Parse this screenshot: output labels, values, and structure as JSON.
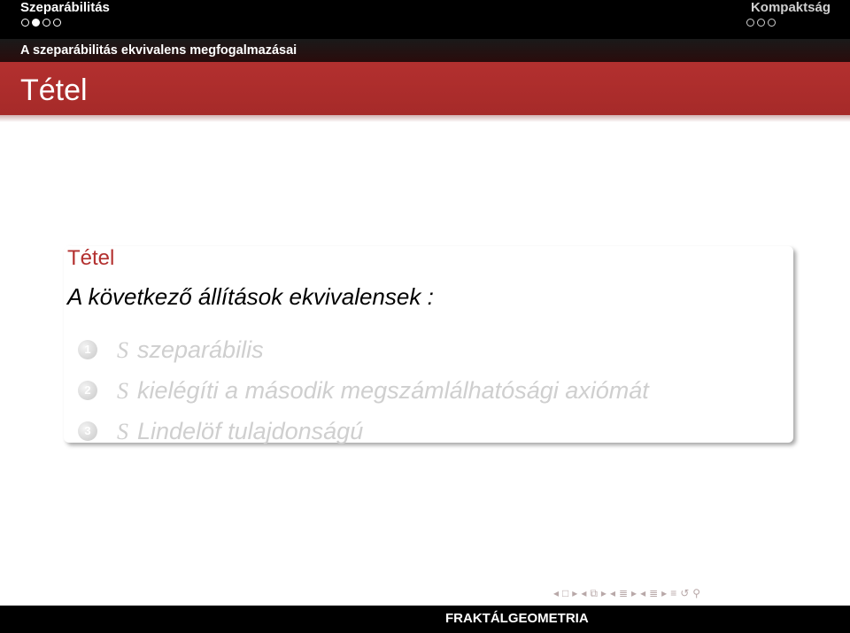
{
  "headline": {
    "section_left": "Szeparábilitás",
    "section_right": "Kompaktság",
    "left_dots": [
      false,
      true,
      false,
      false
    ],
    "right_dots": [
      false,
      false,
      false
    ]
  },
  "subsection": "A szeparábilitás ekvivalens megfogalmazásai",
  "frame_title": "Tétel",
  "theorem": {
    "title": "Tétel",
    "intro": "A következő állítások ekvivalensek :",
    "items": [
      {
        "num": "1",
        "symbol": "S",
        "text": "szeparábilis"
      },
      {
        "num": "2",
        "symbol": "S",
        "text": "kielégíti a második megszámlálhatósági axiómát"
      },
      {
        "num": "3",
        "symbol": "S",
        "text": "Lindelöf tulajdonságú"
      }
    ]
  },
  "navigation": {
    "icons": [
      "nav-prev-arrow",
      "frame-icon",
      "nav-next-arrow",
      "nav-prev-arrow",
      "subsection-icon",
      "nav-next-arrow",
      "nav-prev-arrow",
      "section-icon",
      "nav-next-arrow",
      "nav-prev-arrow",
      "section-icon",
      "nav-next-arrow",
      "align-icon",
      "undo-icon",
      "search-icon"
    ]
  },
  "footer": "FRAKTÁLGEOMETRIA",
  "colors": {
    "accent": "#b3302f",
    "header": "#000000",
    "inactive_text": "#cfcfcf"
  }
}
